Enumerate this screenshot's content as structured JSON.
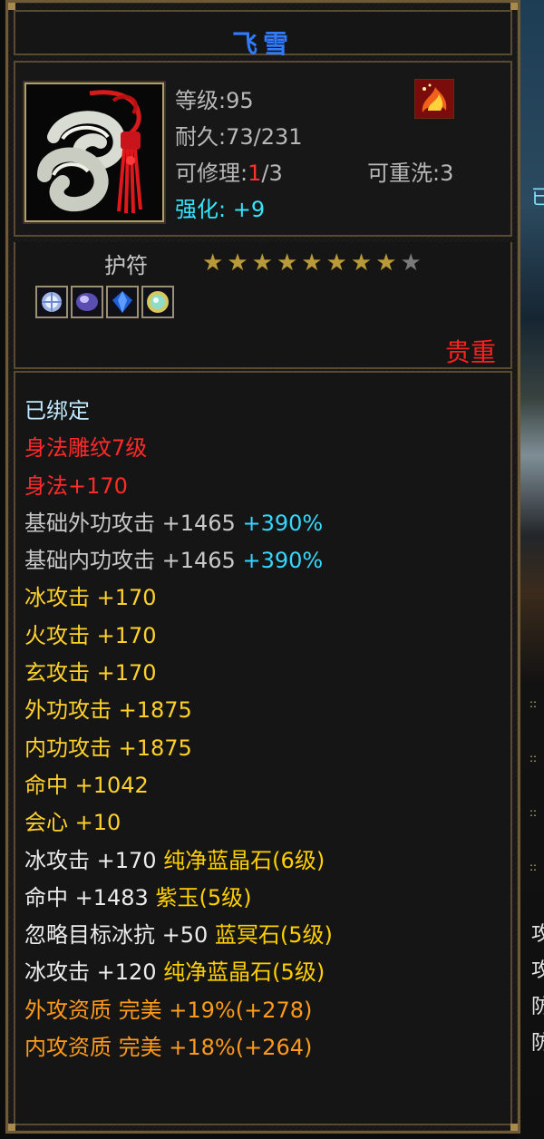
{
  "item": {
    "name": "飞雪",
    "level_label": "等级",
    "level": ":95",
    "durability_label": "耐久",
    "durability": ":73/231",
    "repair_label": "可修理",
    "repair_colon": ":",
    "repair_current": "1",
    "repair_max": "/3",
    "reroll_label": "可重洗",
    "reroll_value": ":3",
    "enhance_label": "强化",
    "enhance_value": ": +9",
    "portrait_icon": "jade-ribbon-charm-icon",
    "badge_icon": "fire-element-icon"
  },
  "charm": {
    "label": "护符",
    "stars_total": 9,
    "stars_filled": 8,
    "gems": [
      "ice-gem-icon",
      "purple-gem-icon",
      "blue-gem-icon",
      "green-gem-icon"
    ],
    "rarity": "贵重"
  },
  "colors": {
    "title": "#2f7cff",
    "rarity": "#ff2020",
    "cyan": "#35e4ff",
    "star_on": "#b99a3a"
  },
  "attributes": {
    "bound": "已绑定",
    "carving": "身法雕纹7级",
    "agility": "身法+170",
    "base_ext_label": "基础外功攻击",
    "base_ext_value": " +1465 ",
    "base_ext_pct": "+390%",
    "base_int_label": "基础内功攻击",
    "base_int_value": " +1465 ",
    "base_int_pct": "+390%",
    "ice_attack": "冰攻击 +170",
    "fire_attack": "火攻击 +170",
    "dark_attack": "玄攻击 +170",
    "ext_attack": "外功攻击 +1875",
    "int_attack": "内功攻击 +1875",
    "hit": "命中 +1042",
    "crit": "会心 +10",
    "gem1_stat": "冰攻击 +170 ",
    "gem1_name": "纯净蓝晶石(6级)",
    "gem2_stat": "命中 +1483 ",
    "gem2_name": "紫玉(5级)",
    "gem3_stat": "忽略目标冰抗 +50 ",
    "gem3_name": "蓝冥石(5级)",
    "gem4_stat": "冰攻击 +120 ",
    "gem4_name": "纯净蓝晶石(5级)",
    "ext_quality": "外攻资质 完美 +19%(+278)",
    "int_quality": "内攻资质 完美 +18%(+264)"
  },
  "background": {
    "right_text_1": "已",
    "right_text_2": "攻",
    "right_text_3": "攻",
    "right_text_4": "防",
    "right_text_5": "防"
  }
}
